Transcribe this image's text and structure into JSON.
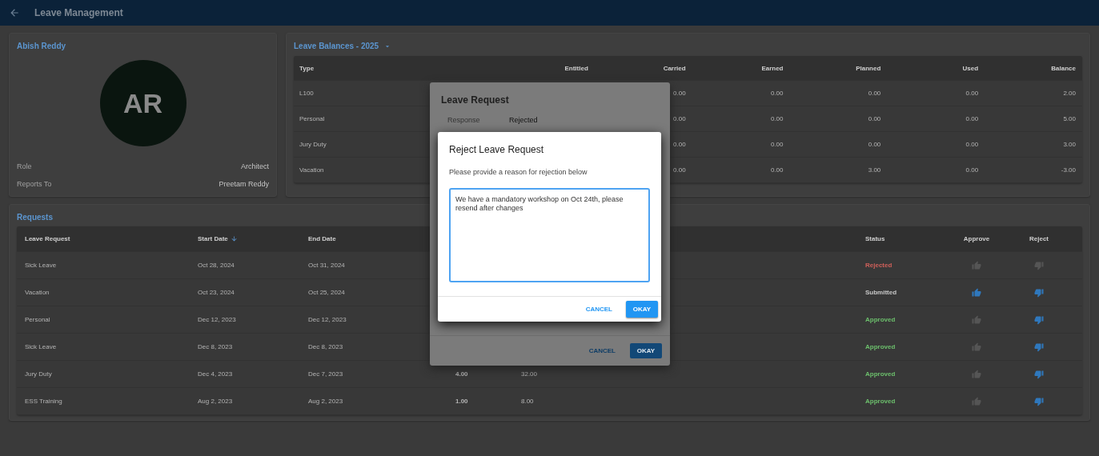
{
  "app_bar": {
    "title": "Leave Management"
  },
  "profile": {
    "name": "Abish Reddy",
    "initials": "AR",
    "fields": [
      {
        "label": "Role",
        "value": "Architect"
      },
      {
        "label": "Reports To",
        "value": "Preetam Reddy"
      }
    ]
  },
  "balances": {
    "title": "Leave Balances - 2025",
    "columns": [
      "Type",
      "Entitled",
      "Carried",
      "Earned",
      "Planned",
      "Used",
      "Balance"
    ],
    "rows": [
      {
        "type": "L100",
        "values": [
          "0.00",
          "0.00",
          "0.00",
          "0.00",
          "2.00"
        ]
      },
      {
        "type": "Personal",
        "values": [
          "0.00",
          "0.00",
          "0.00",
          "0.00",
          "5.00"
        ]
      },
      {
        "type": "Jury Duty",
        "values": [
          "0.00",
          "0.00",
          "0.00",
          "0.00",
          "3.00"
        ]
      },
      {
        "type": "Vacation",
        "values": [
          "0.00",
          "0.00",
          "3.00",
          "0.00",
          "-3.00"
        ]
      }
    ]
  },
  "requests": {
    "title": "Requests",
    "columns": [
      "Leave Request",
      "Start Date",
      "End Date",
      "Status",
      "Approve",
      "Reject"
    ],
    "rows": [
      {
        "leave_request": "Sick Leave",
        "start_date": "Oct 28, 2024",
        "end_date": "Oct 31, 2024",
        "status": "Rejected",
        "color": "#d0605a",
        "approve_disabled": true,
        "reject_disabled": true
      },
      {
        "leave_request": "Vacation",
        "start_date": "Oct 23, 2024",
        "end_date": "Oct 25, 2024",
        "status": "Submitted",
        "color": "#c8c8c8",
        "approve_disabled": false,
        "reject_disabled": false
      },
      {
        "leave_request": "Personal",
        "start_date": "Dec 12, 2023",
        "end_date": "Dec 12, 2023",
        "status": "Approved",
        "color": "#6cbf6c",
        "approve_disabled": true,
        "reject_disabled": false
      },
      {
        "leave_request": "Sick Leave",
        "start_date": "Dec 8, 2023",
        "end_date": "Dec 8, 2023",
        "status": "Approved",
        "color": "#6cbf6c",
        "approve_disabled": true,
        "reject_disabled": false
      },
      {
        "leave_request": "Jury Duty",
        "start_date": "Dec 4, 2023",
        "end_date": "Dec 7, 2023",
        "column_4": "4.00",
        "column_5": "32.00",
        "status": "Approved",
        "color": "#6cbf6c",
        "approve_disabled": true,
        "reject_disabled": false
      },
      {
        "leave_request": "ESS Training",
        "start_date": "Aug 2, 2023",
        "end_date": "Aug 2, 2023",
        "column_4": "1.00",
        "column_5": "8.00",
        "status": "Approved",
        "color": "#6cbf6c",
        "approve_disabled": true,
        "reject_disabled": false
      }
    ]
  },
  "leave_request_dialog": {
    "title": "Leave Request",
    "fields": [
      {
        "label": "Response",
        "value": "Rejected"
      }
    ],
    "buttons": [
      "CANCEL",
      "OKAY"
    ]
  },
  "reject_dialog": {
    "title": "Reject Leave Request",
    "prompt": "Please provide a reason for rejection below",
    "reason": "We have a mandatory workshop on Oct 24th, please resend after changes",
    "buttons": [
      "CANCEL",
      "OKAY"
    ]
  }
}
